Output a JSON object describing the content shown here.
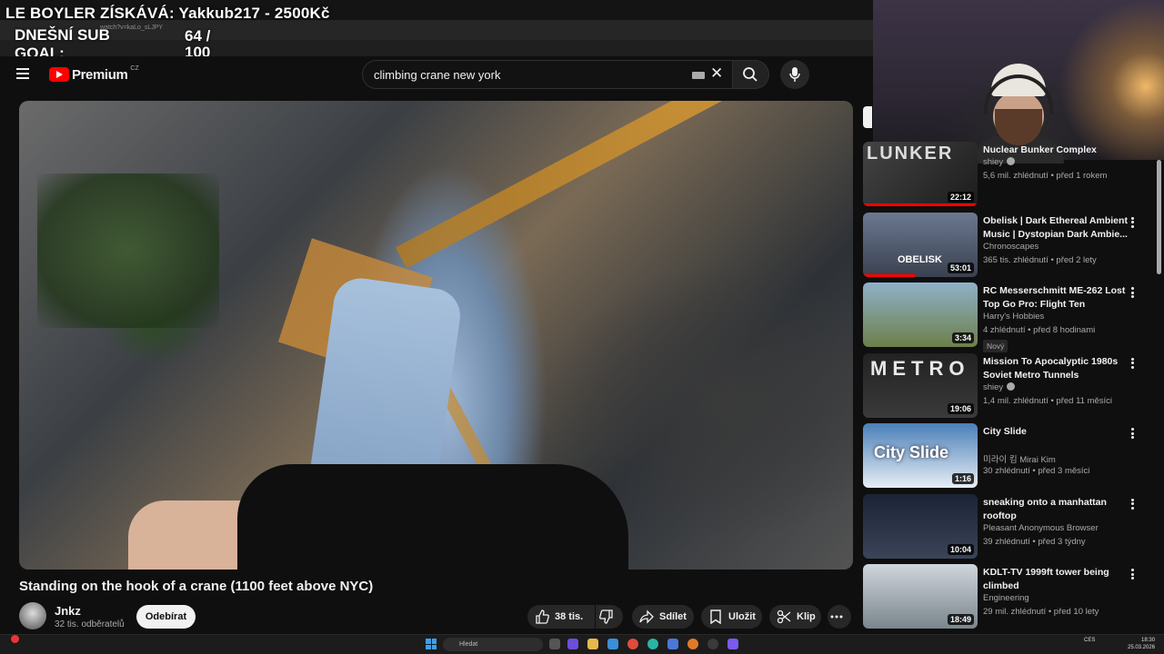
{
  "overlay": {
    "title": "LE BOYLER ZÍSKÁVÁ: Yakkub217 - 2500Kč",
    "goal_label": "DNEŠNÍ SUB GOAL:",
    "goal_count": "64 / 100"
  },
  "browser": {
    "url_fragment": "watch?v=kaLo_sLJPY"
  },
  "header": {
    "logo_text": "Premium",
    "country_code": "CZ",
    "search_value": "climbing crane new york"
  },
  "video": {
    "title": "Standing on the hook of a crane (1100 feet above NYC)",
    "channel": "Jnkz",
    "subscribers": "32 tis. odběratelů",
    "subscribe_label": "Odebírat",
    "like_count": "38 tis.",
    "share_label": "Sdílet",
    "save_label": "Uložit",
    "clip_label": "Klip"
  },
  "recommendations": [
    {
      "title": "Nuclear Bunker Complex",
      "channel": "shiey",
      "verified": true,
      "meta": "5,6 mil. zhlédnutí • před 1 rokem",
      "duration": "22:12",
      "watched": 1.0,
      "thumb_word": "LUNKER"
    },
    {
      "title": "Obelisk | Dark Ethereal Ambient Music | Dystopian Dark Ambie...",
      "channel": "Chronoscapes",
      "verified": false,
      "meta": "365 tis. zhlédnutí • před 2 lety",
      "duration": "53:01",
      "watched": 0.45,
      "thumb_word": "OBELISK"
    },
    {
      "title": "RC Messerschmitt ME-262 Lost Top Go Pro: Flight Ten",
      "channel": "Harry's Hobbies",
      "verified": false,
      "meta": "4 zhlédnutí • před 8 hodinami",
      "duration": "3:34",
      "badge": "Nový",
      "watched": 0,
      "thumb_word": ""
    },
    {
      "title": "Mission To Apocalyptic 1980s Soviet Metro Tunnels",
      "channel": "shiey",
      "verified": true,
      "meta": "1,4 mil. zhlédnutí • před 11 měsíci",
      "duration": "19:06",
      "watched": 0,
      "thumb_word": "METRO"
    },
    {
      "title": "City Slide",
      "channel": "미라이 킴 Mirai Kim",
      "verified": false,
      "meta": "30 zhlédnutí • před 3 měsíci",
      "duration": "1:16",
      "watched": 0,
      "thumb_word": "City Slide"
    },
    {
      "title": "sneaking onto a manhattan rooftop",
      "channel": "Pleasant Anonymous Browser",
      "verified": false,
      "meta": "39 zhlédnutí • před 3 týdny",
      "duration": "10:04",
      "watched": 0,
      "thumb_word": ""
    },
    {
      "title": "KDLT-TV 1999ft tower being climbed",
      "channel": "Engineering",
      "verified": false,
      "meta": "29 mil. zhlédnutí • před 10 lety",
      "duration": "18:49",
      "watched": 0,
      "thumb_word": ""
    }
  ],
  "taskbar": {
    "search_placeholder": "Hledat",
    "tray_lang": "CES",
    "time": "18:30",
    "date": "25.03.2026"
  },
  "colors": {
    "youtube_red": "#ff0000",
    "background": "#0f0f0f",
    "pill": "#272727",
    "muted_text": "#aaaaaa"
  }
}
